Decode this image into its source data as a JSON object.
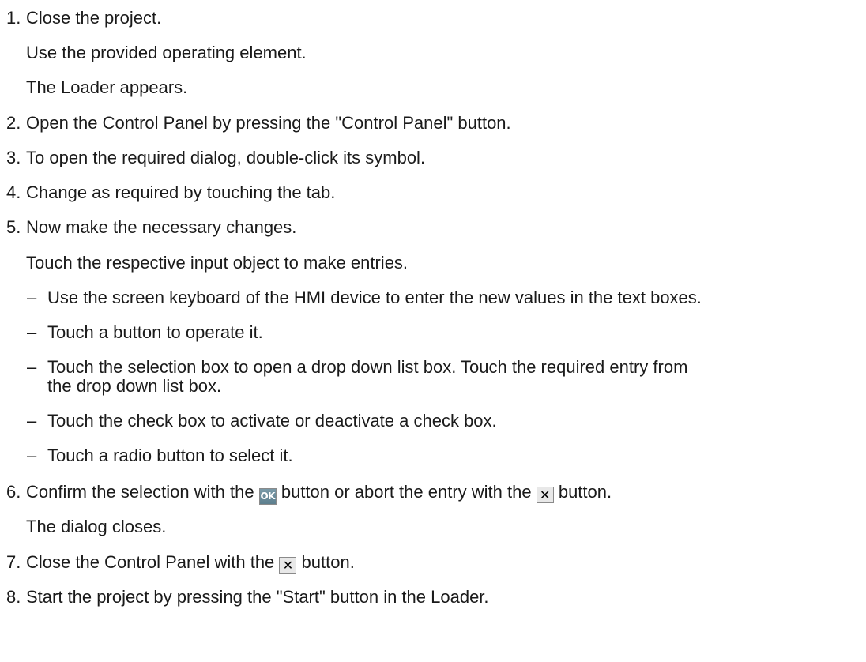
{
  "steps": [
    {
      "num": "1.",
      "text": "Close the project.",
      "sub": [
        "Use the provided operating element.",
        "The Loader appears."
      ]
    },
    {
      "num": "2.",
      "text": "Open the Control Panel by pressing the \"Control Panel\" button."
    },
    {
      "num": "3.",
      "text": "To open the required dialog, double-click its symbol."
    },
    {
      "num": "4.",
      "text": "Change as required by touching the tab."
    },
    {
      "num": "5.",
      "text": "Now make the necessary changes.",
      "sub": [
        "Touch the respective input object to make entries."
      ],
      "bullets": [
        {
          "dash": "–",
          "lines": [
            "Use the screen keyboard of the HMI device to enter the new values in the text boxes."
          ]
        },
        {
          "dash": "–",
          "lines": [
            "Touch a button to operate it."
          ]
        },
        {
          "dash": "–",
          "lines": [
            "Touch the selection box to open a drop down list box. Touch the required entry from",
            "the drop down list box."
          ]
        },
        {
          "dash": "–",
          "lines": [
            "Touch the check box to activate or deactivate a check box."
          ]
        },
        {
          "dash": "–",
          "lines": [
            "Touch a radio button to select it."
          ]
        }
      ]
    },
    {
      "num": "6.",
      "text_a": "Confirm the selection with the",
      "text_b": "button or abort the entry with the",
      "text_c": "button.",
      "sub": [
        "The dialog closes."
      ]
    },
    {
      "num": "7.",
      "text_a": "Close the Control Panel with the",
      "text_b": "button."
    },
    {
      "num": "8.",
      "text": "Start the project by pressing the \"Start\" button in the Loader."
    }
  ],
  "icons": {
    "ok_label": "OK",
    "close_label": "✕"
  }
}
